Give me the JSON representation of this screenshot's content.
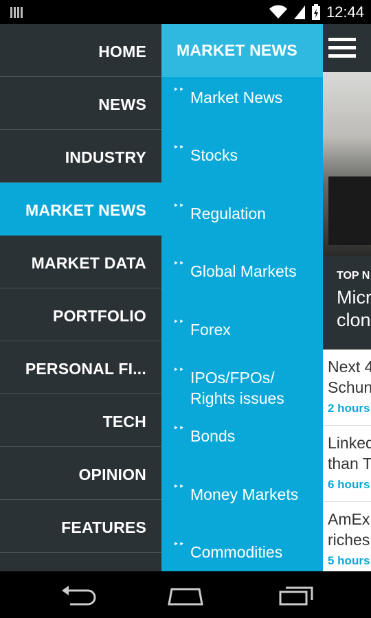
{
  "status_bar": {
    "time": "12:44",
    "icons": [
      "signal-bars-icon",
      "wifi-icon",
      "cell-signal-icon",
      "battery-icon"
    ]
  },
  "left_nav": {
    "items": [
      {
        "label": "HOME",
        "active": false
      },
      {
        "label": "NEWS",
        "active": false
      },
      {
        "label": "INDUSTRY",
        "active": false
      },
      {
        "label": "MARKET NEWS",
        "active": true
      },
      {
        "label": "MARKET DATA",
        "active": false
      },
      {
        "label": "PORTFOLIO",
        "active": false
      },
      {
        "label": "PERSONAL FI...",
        "active": false
      },
      {
        "label": "TECH",
        "active": false
      },
      {
        "label": "OPINION",
        "active": false
      },
      {
        "label": "FEATURES",
        "active": false
      }
    ]
  },
  "sub_menu": {
    "title": "MARKET NEWS",
    "items": [
      {
        "label": "Market News"
      },
      {
        "label": "Stocks"
      },
      {
        "label": "Regulation"
      },
      {
        "label": "Global Markets"
      },
      {
        "label": "Forex"
      },
      {
        "label": "IPOs/FPOs/ Rights issues"
      },
      {
        "label": "Bonds"
      },
      {
        "label": "Money Markets"
      },
      {
        "label": "Commodities"
      }
    ]
  },
  "content": {
    "top_label": "TOP N",
    "top_headline_line1": "Micr",
    "top_headline_line2": "clon",
    "stories": [
      {
        "line1": "Next 4",
        "line2": "Schun",
        "time": "2 hours"
      },
      {
        "line1": "Linked",
        "line2": "than T",
        "time": "6 hours"
      },
      {
        "line1": "AmEx",
        "line2": "riches",
        "time": "5 hours"
      }
    ]
  },
  "colors": {
    "accent": "#0aa8d8",
    "nav_bg": "#2b3236",
    "sub_header_bg": "#2fb9e0"
  }
}
